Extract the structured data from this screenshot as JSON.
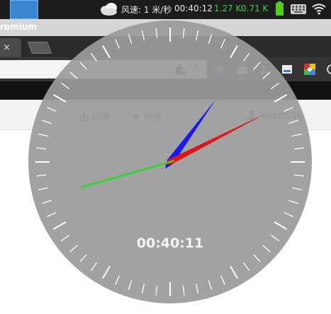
{
  "system_panel": {
    "weather": "风速: 1 米/秒",
    "clock": "00:40:12",
    "net_up": "1.27 K",
    "net_down": "0.71 K",
    "icons": [
      "weather-cloud-icon",
      "battery-icon",
      "keyboard-icon",
      "wifi-icon"
    ]
  },
  "browser": {
    "title": "romium",
    "tab_close": "×",
    "star": "☆",
    "extensions": [
      "puzzle-extension-icon",
      "wifi-extension-icon",
      "calendar-extension-icon",
      "person-extension-icon",
      "screenshot-extension-icon",
      "chrome-extension-icon"
    ]
  },
  "site_nav": {
    "vote": "投票",
    "favorites": "收藏",
    "username": "wszxl516"
  },
  "clock": {
    "digital_time": "00:40:11",
    "hours": 0,
    "minutes": 40,
    "seconds": 11,
    "face_color": "#9b9b9b",
    "hour_hand_color": "#1a1af0",
    "minute_hand_color": "#e01515",
    "second_hand_color": "#22dd22"
  },
  "colors": {
    "net_speed": "#3fd13f",
    "battery": "#55cc22"
  }
}
